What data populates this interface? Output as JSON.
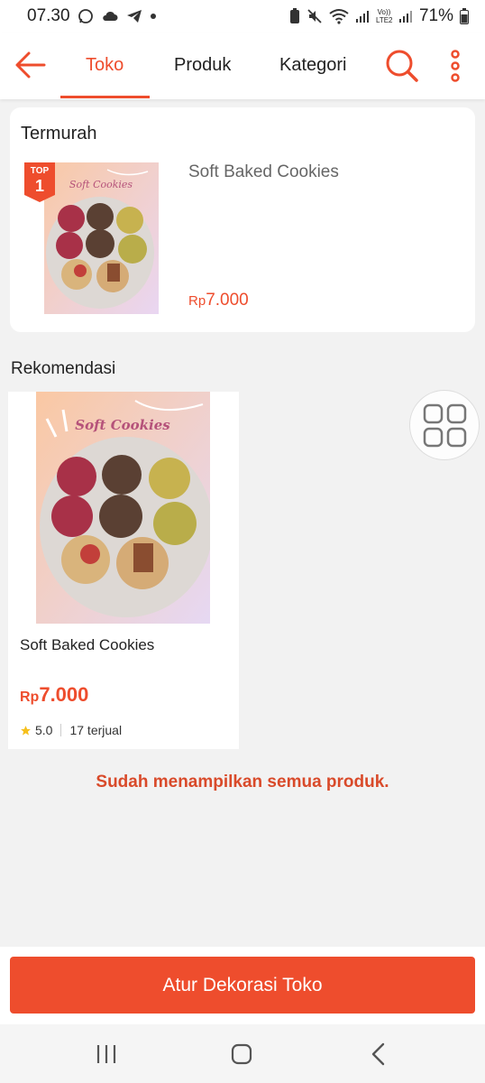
{
  "status_bar": {
    "time": "07.30",
    "battery": "71%",
    "network_label": "Vo)) LTE2"
  },
  "nav": {
    "tabs": [
      {
        "label": "Toko",
        "active": true
      },
      {
        "label": "Produk",
        "active": false
      },
      {
        "label": "Kategori",
        "active": false
      }
    ],
    "accent_color": "#ee4d2d"
  },
  "cheapest": {
    "title": "Termurah",
    "badge_top": "TOP",
    "badge_rank": "1",
    "image_caption": "Soft Cookies",
    "product_name": "Soft Baked Cookies",
    "currency": "Rp",
    "price": "7.000"
  },
  "recommendations": {
    "title": "Rekomendasi",
    "items": [
      {
        "image_caption": "Soft Cookies",
        "name": "Soft Baked Cookies",
        "currency": "Rp",
        "price": "7.000",
        "rating": "5.0",
        "sold": "17 terjual"
      }
    ]
  },
  "end_message": "Sudah menampilkan semua produk.",
  "decorate_button": "Atur Dekorasi Toko",
  "icons": {
    "back": "arrow-left-icon",
    "search": "search-icon",
    "more": "more-vertical-icon",
    "grid": "grid-view-icon",
    "star": "star-icon"
  }
}
